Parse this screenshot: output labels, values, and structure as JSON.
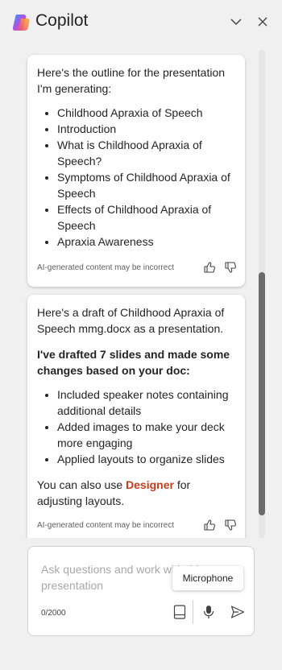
{
  "header": {
    "title": "Copilot",
    "logo_icon": "copilot-logo-icon",
    "collapse_icon": "chevron-down-icon",
    "close_icon": "close-icon"
  },
  "messages": [
    {
      "intro": "Here's the outline for the presentation I'm generating:",
      "bullets": [
        "Childhood Apraxia of Speech",
        "Introduction",
        "What is Childhood Apraxia of Speech?",
        "Symptoms of Childhood Apraxia of Speech",
        "Effects of Childhood Apraxia of Speech",
        "Apraxia Awareness"
      ],
      "footer": "AI-generated content may be incorrect"
    },
    {
      "intro": "Here's a draft of Childhood Apraxia of Speech mmg.docx as a presentation.",
      "bold_line": "I've drafted 7 slides and made some changes based on your doc:",
      "bullets": [
        "Included speaker notes containing additional details",
        "Added images to make your deck more engaging",
        "Applied layouts to organize slides"
      ],
      "outro_before": "You can also use ",
      "outro_link": "Designer",
      "outro_after": " for adjusting layouts.",
      "footer": "AI-generated content may be incorrect"
    }
  ],
  "composer": {
    "placeholder": "Ask questions and work with this presentation",
    "counter": "0/2000",
    "tooltip": "Microphone"
  },
  "colors": {
    "accent_link": "#c43e1c",
    "background": "#f0f0f0"
  }
}
